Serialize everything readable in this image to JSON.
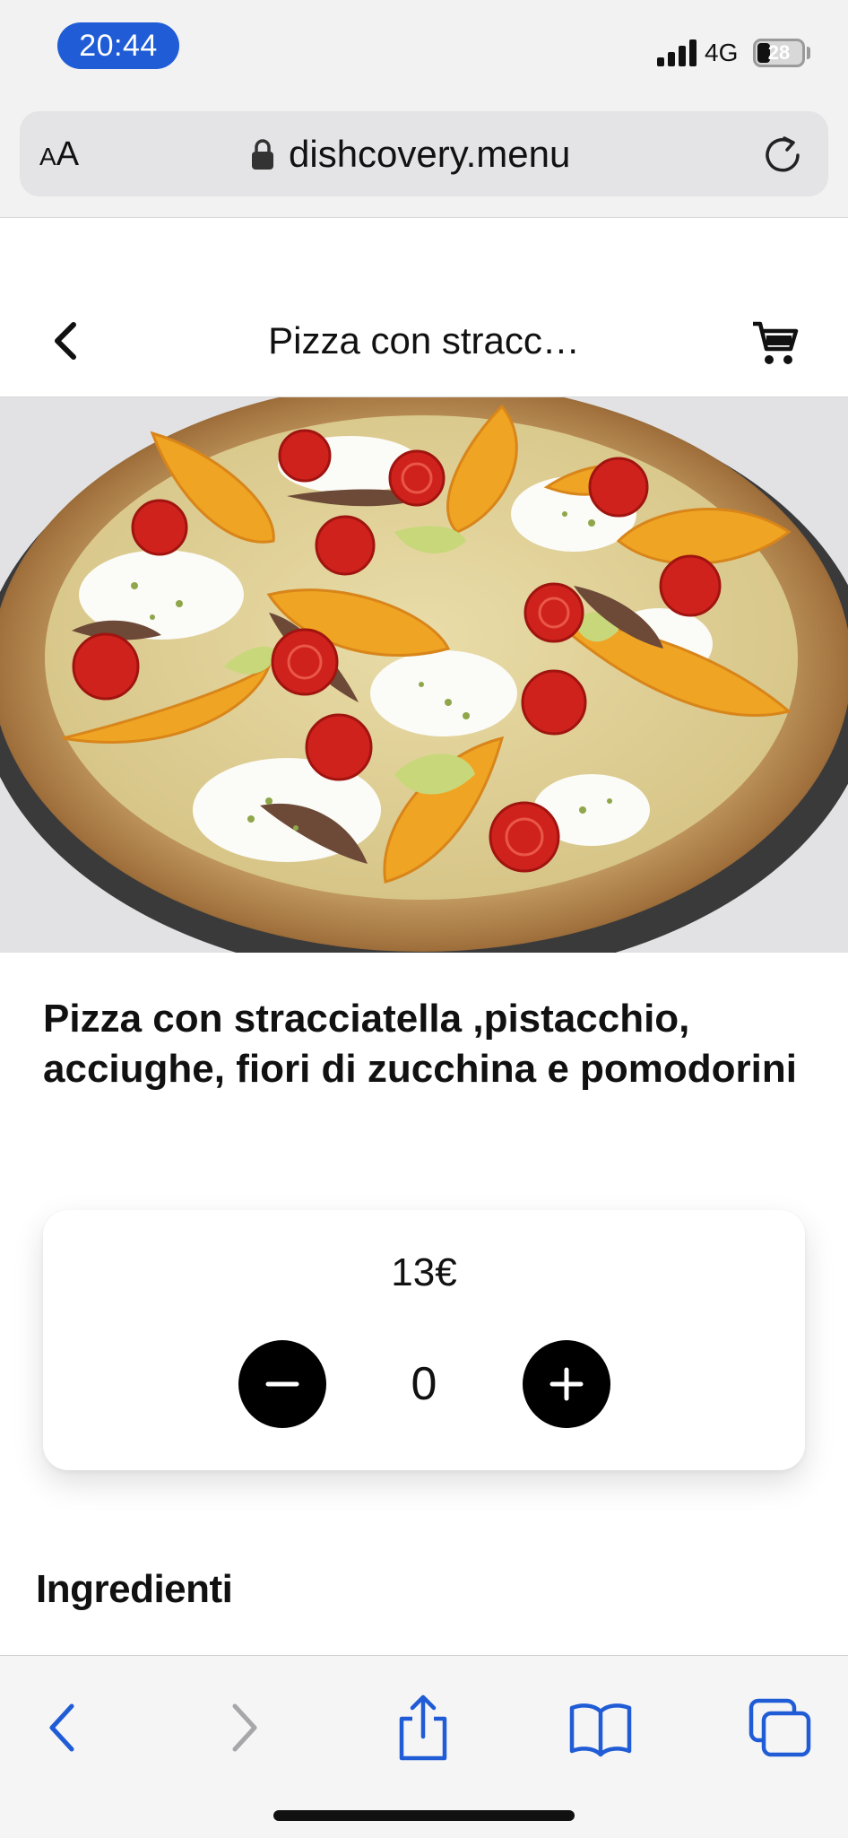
{
  "status_bar": {
    "time": "20:44",
    "network": "4G",
    "battery": "28",
    "time_pill_color": "#1f5cd6"
  },
  "browser": {
    "text_size_label_small": "A",
    "text_size_label_large": "A",
    "url": "dishcovery.menu",
    "icons": [
      "lock-icon",
      "reload-icon"
    ]
  },
  "header": {
    "title": "Pizza con stracc…",
    "icons": [
      "chevron-left-icon",
      "cart-icon"
    ]
  },
  "dish": {
    "image_alt": "pizza-photo",
    "name": "Pizza con stracciatella ,pistacchio, acciughe, fiori di zucchina e pomodorini",
    "price": "13€",
    "quantity": "0"
  },
  "sections": {
    "ingredients_heading": "Ingredienti"
  },
  "toolbar": {
    "icons": [
      "back-icon",
      "forward-icon",
      "share-icon",
      "bookmarks-icon",
      "tabs-icon"
    ],
    "accent_color": "#1f5cd6"
  }
}
